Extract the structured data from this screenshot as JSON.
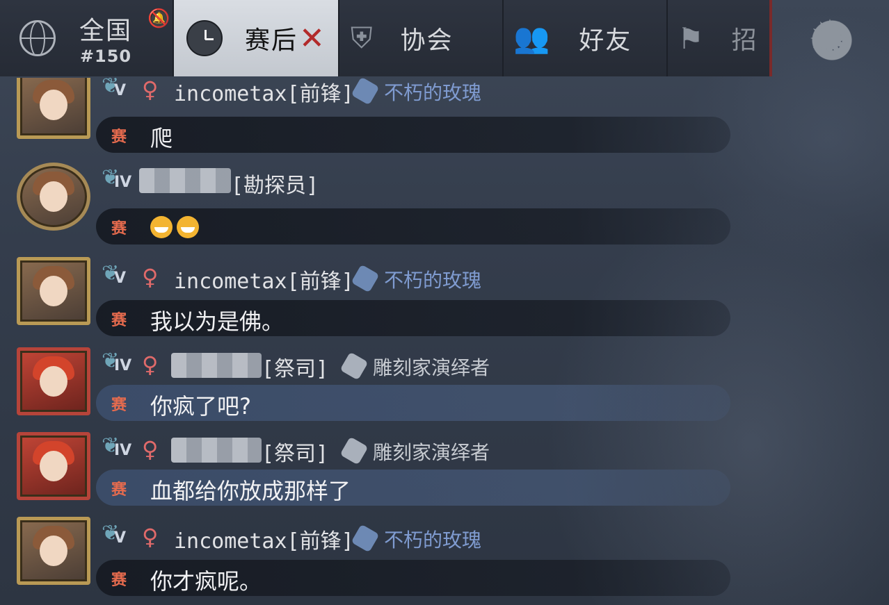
{
  "tabs": [
    {
      "label": "全国",
      "sublabel": "#150",
      "icon": "globe-icon"
    },
    {
      "label": "赛后",
      "icon": "clock-icon",
      "active": true
    },
    {
      "label": "协会",
      "icon": "shield-icon"
    },
    {
      "label": "好友",
      "icon": "friends-icon"
    },
    {
      "label": "招",
      "icon": "flag-icon"
    }
  ],
  "settings_icon": "gear-icon",
  "mute_icon": "muted-bell-icon",
  "close_mark": "✕",
  "messages": [
    {
      "rank": "V",
      "gender": "♀",
      "name": "incometax[前锋]",
      "tag": "不朽的玫瑰",
      "channel": "赛",
      "text": "爬"
    },
    {
      "rank": "IV",
      "gender": "",
      "name": "[勘探员]",
      "tag": "",
      "channel": "赛",
      "text": ""
    },
    {
      "rank": "V",
      "gender": "♀",
      "name": "incometax[前锋]",
      "tag": "不朽的玫瑰",
      "channel": "赛",
      "text": "我以为是佛。"
    },
    {
      "rank": "IV",
      "gender": "♀",
      "name": "[祭司]",
      "tag": "雕刻家演绎者",
      "channel": "赛",
      "text": "你疯了吧?"
    },
    {
      "rank": "IV",
      "gender": "♀",
      "name": "[祭司]",
      "tag": "雕刻家演绎者",
      "channel": "赛",
      "text": "血都给你放成那样了"
    },
    {
      "rank": "V",
      "gender": "♀",
      "name": "incometax[前锋]",
      "tag": "不朽的玫瑰",
      "channel": "赛",
      "text": "你才疯呢。"
    }
  ],
  "colors": {
    "accent_red": "#b22a2a",
    "channel_orange": "#e66b4e",
    "tag_blue": "#7f9bd0",
    "gender_pink": "#e06a6a"
  }
}
